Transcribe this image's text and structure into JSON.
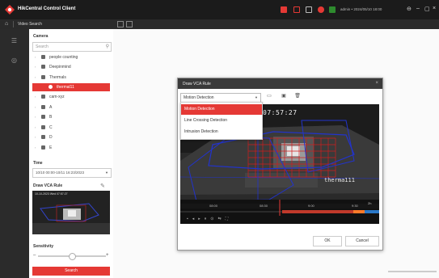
{
  "app": {
    "title": "HikCentral Control Client",
    "page_tab": "Video Search",
    "clock": "admin • 2024/05/10 18:00"
  },
  "left_panel": {
    "camera_label": "Camera",
    "search_placeholder": "Search",
    "tree": [
      {
        "name": "people counting",
        "selected": false
      },
      {
        "name": "Deepinmind",
        "selected": false
      },
      {
        "name": "Thermals",
        "selected": false
      },
      {
        "name": "thermal11",
        "selected": true
      },
      {
        "name": "cam-xyz",
        "selected": false
      },
      {
        "name": "A",
        "selected": false
      },
      {
        "name": "B",
        "selected": false
      },
      {
        "name": "C",
        "selected": false
      },
      {
        "name": "D",
        "selected": false
      },
      {
        "name": "E",
        "selected": false
      }
    ],
    "time_label": "Time",
    "time_value": "10/10 00:00-10/11 16:23/2023",
    "draw_label": "Draw VCA Rule",
    "thumb_stamp": "10-10-2023 Wed 07:57:27",
    "sensitivity_label": "Sensitivity",
    "sensitivity_value": 0.5,
    "search_button": "Search"
  },
  "dialog": {
    "title": "Draw VCA Rule",
    "close": "×",
    "selected_rule": "Motion Detection",
    "options": [
      "Motion Detection",
      "Line Crossing Detection",
      "Intrusion Detection"
    ],
    "video_time": "07:57:27",
    "video_label": "therma111",
    "timeline_ticks": [
      "08:00",
      "08:30",
      "9:00",
      "9:30"
    ],
    "timeline_hours": "2h",
    "ok": "OK",
    "cancel": "Cancel"
  },
  "colors": {
    "accent": "#e53935",
    "titlebar": "#1b1b1b"
  }
}
